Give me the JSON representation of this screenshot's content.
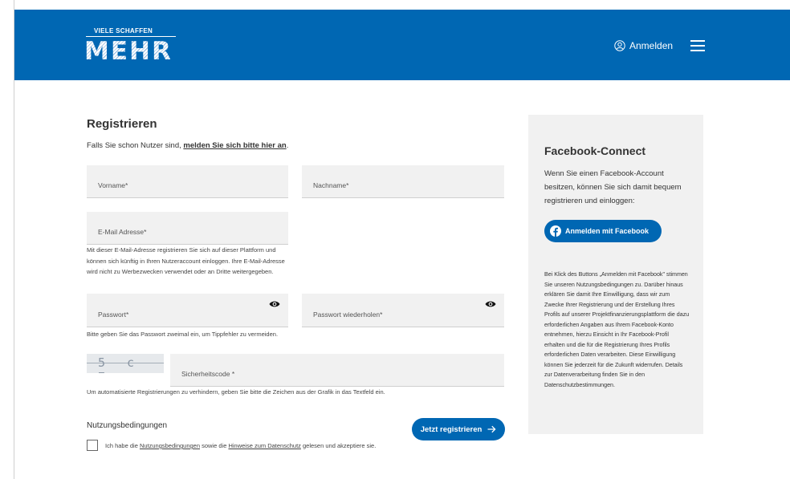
{
  "header": {
    "logo_small": "VIELE SCHAFFEN",
    "logo_big": "MEHR",
    "login_label": "Anmelden",
    "icons": {
      "user": "user-icon",
      "menu": "hamburger-menu-icon"
    },
    "brand_color": "#0067b3"
  },
  "form": {
    "title": "Registrieren",
    "intro_text": "Falls Sie schon Nutzer sind, ",
    "intro_link": "melden Sie sich bitte hier an",
    "intro_end": ".",
    "fields": {
      "firstname": {
        "label": "Vorname*",
        "value": ""
      },
      "lastname": {
        "label": "Nachname*",
        "value": ""
      },
      "email": {
        "label": "E-Mail Adresse*",
        "value": ""
      },
      "password": {
        "label": "Passwort*",
        "value": ""
      },
      "password_repeat": {
        "label": "Passwort wiederholen*",
        "value": ""
      },
      "captcha": {
        "label": "Sicherheitscode *",
        "value": ""
      }
    },
    "email_hint": "Mit dieser E-Mail-Adresse registrieren Sie sich auf dieser Plattform und können sich künftig in Ihren Nutzeraccount einloggen. Ihre E-Mail-Adresse wird nicht zu Werbezwecken verwendet oder an Dritte weitergegeben.",
    "password_hint": "Bitte geben Sie das Passwort zweimal ein, um Tippfehler zu vermeiden.",
    "captcha_text": "5 c 7 c",
    "captcha_hint": "Um automatisierte Registrierungen zu verhindern, geben Sie bitte die Zeichen aus der Grafik in das Textfeld ein.",
    "terms_title": "Nutzungsbedingungen",
    "terms_pre": "Ich habe die ",
    "terms_link1": "Nutzungsbedingungen",
    "terms_mid": " sowie die ",
    "terms_link2": "Hinweise zum Datenschutz",
    "terms_post": " gelesen und akzeptiere sie.",
    "terms_checked": false,
    "submit_label": "Jetzt registrieren",
    "submit_icon": "arrow-right-icon"
  },
  "facebook": {
    "title": "Facebook-Connect",
    "description": "Wenn Sie einen Facebook-Account besitzen, können Sie sich damit bequem registrieren und einloggen:",
    "button_label": "Anmelden mit Facebook",
    "button_icon": "facebook-icon",
    "legal_text": "Bei Klick des Buttons „Anmelden mit Facebook\" stimmen Sie unseren Nutzungsbedingungen zu. Darüber hinaus erklären Sie damit Ihre Einwilligung, dass wir zum Zwecke Ihrer Registrierung und der Erstellung Ihres Profils auf unserer Projektfinanzierungsplattform die dazu erforderlichen Angaben aus Ihrem Facebook-Konto entnehmen, hierzu Einsicht in Ihr Facebook-Profil erhalten und die für die Registrierung Ihres Profils erforderlichen Daten verarbeiten. Diese Einwilligung können Sie jederzeit für die Zukunft widerrufen. Details zur Datenverarbeitung finden Sie in den Datenschutzbestimmungen."
  }
}
